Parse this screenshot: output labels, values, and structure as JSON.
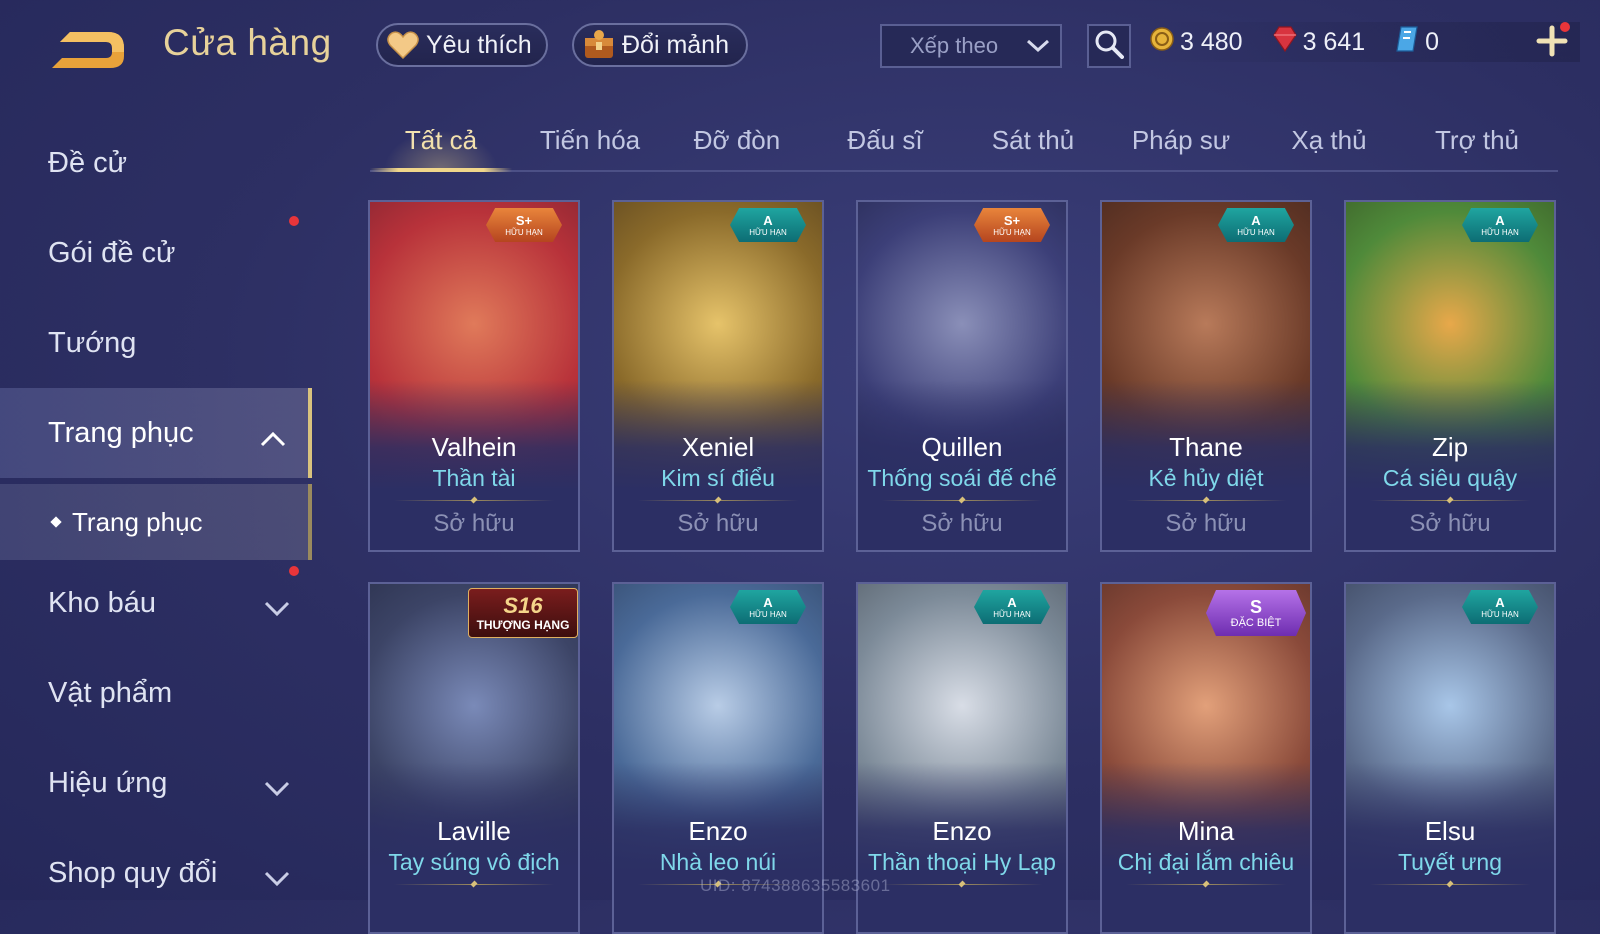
{
  "header": {
    "title": "Cửa hàng",
    "favorite_label": "Yêu thích",
    "shard_label": "Đổi mảnh",
    "sort_placeholder": "Xếp theo",
    "currencies": [
      {
        "icon": "gold-coin-icon",
        "value": "3 480"
      },
      {
        "icon": "ruby-gem-icon",
        "value": "3 641"
      },
      {
        "icon": "voucher-icon",
        "value": "0"
      }
    ]
  },
  "sidebar": {
    "items": [
      {
        "label": "Đề cử"
      },
      {
        "label": "Gói đề cử"
      },
      {
        "label": "Tướng"
      },
      {
        "label": "Trang phục"
      },
      {
        "label": "Trang phục"
      },
      {
        "label": "Kho báu"
      },
      {
        "label": "Vật phẩm"
      },
      {
        "label": "Hiệu ứng"
      },
      {
        "label": "Shop quy đổi"
      }
    ]
  },
  "tabs": [
    "Tất cả",
    "Tiến hóa",
    "Đỡ đòn",
    "Đấu sĩ",
    "Sát thủ",
    "Pháp sư",
    "Xạ thủ",
    "Trợ thủ"
  ],
  "cards": [
    {
      "hero": "Valhein",
      "skin": "Thần tài",
      "status": "Sở hữu",
      "badge_grade": "S+",
      "badge_sub": "HỮU HẠN",
      "badge_color": "#d7652a",
      "art_color": "#b8323a"
    },
    {
      "hero": "Xeniel",
      "skin": "Kim sí điểu",
      "status": "Sở hữu",
      "badge_grade": "A",
      "badge_sub": "HỮU HẠN",
      "badge_color": "#16898a",
      "art_color": "#8a6a2a"
    },
    {
      "hero": "Quillen",
      "skin": "Thống soái đế chế",
      "status": "Sở hữu",
      "badge_grade": "S+",
      "badge_sub": "HỮU HẠN",
      "badge_color": "#d7652a",
      "art_color": "#3c3f78"
    },
    {
      "hero": "Thane",
      "skin": "Kẻ hủy diệt",
      "status": "Sở hữu",
      "badge_grade": "A",
      "badge_sub": "HỮU HẠN",
      "badge_color": "#16898a",
      "art_color": "#6a3a28"
    },
    {
      "hero": "Zip",
      "skin": "Cá siêu quậy",
      "status": "Sở hữu",
      "badge_grade": "A",
      "badge_sub": "HỮU HẠN",
      "badge_color": "#16898a",
      "art_color": "#4f8a3a"
    },
    {
      "hero": "Laville",
      "skin": "Tay súng vô địch",
      "badge_grade": "S16",
      "badge_sub": "THƯỢNG HẠNG",
      "badge_color": "#7a1d1d",
      "art_color": "#3c4466"
    },
    {
      "hero": "Enzo",
      "skin": "Nhà leo núi",
      "badge_grade": "A",
      "badge_sub": "HỮU HẠN",
      "badge_color": "#16898a",
      "art_color": "#4a6a98"
    },
    {
      "hero": "Enzo",
      "skin": "Thần thoại Hy Lạp",
      "badge_grade": "A",
      "badge_sub": "HỮU HẠN",
      "badge_color": "#16898a",
      "art_color": "#7c8a98"
    },
    {
      "hero": "Mina",
      "skin": "Chị đại lắm chiêu",
      "badge_grade": "S",
      "badge_sub": "ĐẶC BIỆT",
      "badge_color": "#8a3ad0",
      "art_color": "#8a4a3a"
    },
    {
      "hero": "Elsu",
      "skin": "Tuyết ưng",
      "badge_grade": "A",
      "badge_sub": "HỮU HẠN",
      "badge_color": "#16898a",
      "art_color": "#5a6a8a"
    }
  ],
  "footer": {
    "uid": "UID: 874388635583601"
  }
}
